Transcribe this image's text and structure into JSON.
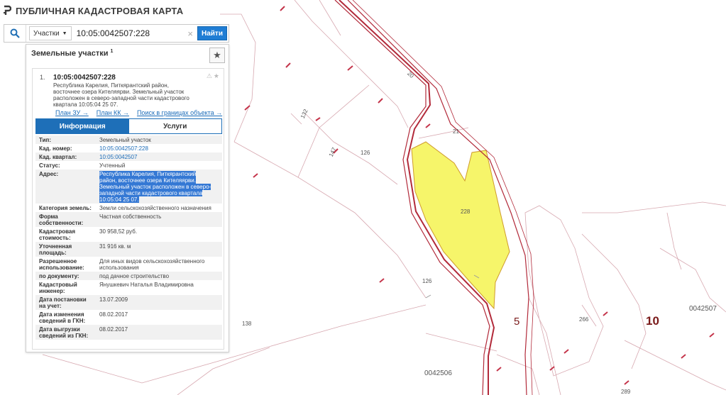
{
  "app": {
    "title": "ПУБЛИЧНАЯ КАДАСТРОВАЯ КАРТА"
  },
  "search": {
    "type_label": "Участки",
    "query": "10:05:0042507:228",
    "button_label": "Найти"
  },
  "panel": {
    "heading": "Земельные участки",
    "heading_count": "1"
  },
  "result": {
    "index": "1.",
    "cadastral_number": "10:05:0042507:228",
    "address_lines": [
      "Республика Карелия, Питкярантский район,",
      "восточнее озера Кителяярви. Земельный участок",
      "расположен в северо-западной части кадастрового",
      "квартала 10:05:04 25 07."
    ],
    "links": {
      "plan_zu": "План ЗУ →",
      "plan_kk": "План КК →",
      "search_within": "Поиск в границах объекта →"
    }
  },
  "tabs": {
    "info": "Информация",
    "services": "Услуги"
  },
  "props": [
    {
      "k": [
        "Тип:"
      ],
      "v": [
        "Земельный участок"
      ]
    },
    {
      "k": [
        "Кад. номер:"
      ],
      "v": [
        "10:05:0042507:228"
      ],
      "link": true
    },
    {
      "k": [
        "Кад. квартал:"
      ],
      "v": [
        "10:05:0042507"
      ],
      "link": true
    },
    {
      "k": [
        "Статус:"
      ],
      "v": [
        "Учтенный"
      ]
    },
    {
      "k": [
        "Адрес:"
      ],
      "v": [
        "Республика Карелия, Питкярантский",
        "район, восточнее озера Кителяярви.",
        "Земельный участок расположен в северо-",
        "западной части кадастрового квартала",
        "10:05:04 25 07."
      ],
      "selected": true
    },
    {
      "k": [
        "Категория земель:"
      ],
      "v": [
        "Земли сельскохозяйственного назначения"
      ]
    },
    {
      "k": [
        "Форма",
        "собственности:"
      ],
      "v": [
        "Частная собственность"
      ]
    },
    {
      "k": [
        "Кадастровая",
        "стоимость:"
      ],
      "v": [
        "30 958,52 руб."
      ]
    },
    {
      "k": [
        "Уточненная",
        "площадь:"
      ],
      "v": [
        "31 916 кв. м"
      ]
    },
    {
      "k": [
        "Разрешенное",
        "использование:"
      ],
      "v": [
        "Для иных видов сельскохозяйственного",
        "использования"
      ]
    },
    {
      "k": [
        "по документу:"
      ],
      "v": [
        "под дачное строительство"
      ]
    },
    {
      "k": [
        "Кадастровый",
        "инженер:"
      ],
      "v": [
        "Янушкевич Наталья Владимировна"
      ]
    },
    {
      "k": [
        "Дата постановки",
        "на учет:"
      ],
      "v": [
        "13.07.2009"
      ]
    },
    {
      "k": [
        "Дата изменения",
        "сведений в ГКН:"
      ],
      "v": [
        "08.02.2017"
      ]
    },
    {
      "k": [
        "Дата выгрузки",
        "сведений из ГКН:"
      ],
      "v": [
        "08.02.2017"
      ]
    }
  ],
  "map_labels": [
    {
      "id": "l-20",
      "text": "20"
    },
    {
      "id": "l-21",
      "text": "21"
    },
    {
      "id": "l-132",
      "text": "132"
    },
    {
      "id": "l-147",
      "text": "147"
    },
    {
      "id": "l-126a",
      "text": "126"
    },
    {
      "id": "l-126b",
      "text": "126"
    },
    {
      "id": "l-228",
      "text": "228"
    },
    {
      "id": "l-138",
      "text": "138"
    },
    {
      "id": "l-266",
      "text": "266"
    },
    {
      "id": "l-289",
      "text": "289"
    },
    {
      "id": "l-5",
      "text": "5"
    },
    {
      "id": "l-10",
      "text": "10"
    },
    {
      "id": "l-0042506",
      "text": "0042506"
    },
    {
      "id": "l-0042507",
      "text": "0042507"
    }
  ],
  "colors": {
    "parcel_fill": "#f6f56a",
    "boundary": "#b22a3a",
    "accent": "#1e6fb8"
  }
}
